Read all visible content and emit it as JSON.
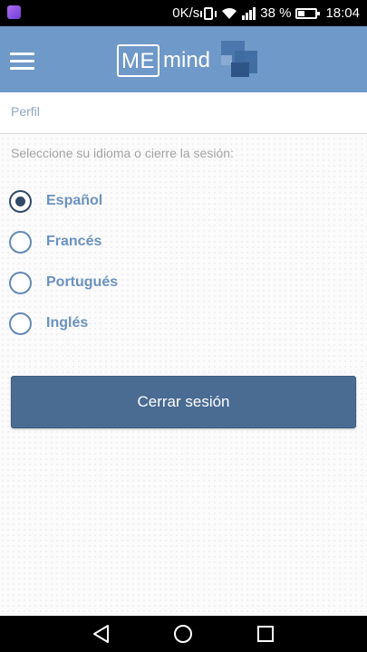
{
  "status_bar": {
    "network_speed": "0K/s",
    "battery_percent": "38 %",
    "battery_level": 0.38,
    "time": "18:04",
    "icons": [
      "app-notification-icon",
      "vibrate-icon",
      "wifi-icon",
      "signal-icon",
      "battery-icon"
    ]
  },
  "app_bar": {
    "menu_icon": "hamburger-menu-icon",
    "logo_me": "ME",
    "logo_mind": "mind",
    "logo_icon": "memind-logo-squares",
    "colors": {
      "background": "#6f99c8",
      "logo_dark": "#3d6a9f"
    }
  },
  "profile": {
    "title": "Perfil",
    "instruction": "Seleccione su idioma o cierre la sesión:",
    "selected_language": "Español",
    "languages": [
      {
        "label": "Español",
        "checked": true
      },
      {
        "label": "Francés",
        "checked": false
      },
      {
        "label": "Portugués",
        "checked": false
      },
      {
        "label": "Inglés",
        "checked": false
      }
    ],
    "logout_label": "Cerrar sesión",
    "colors": {
      "accent": "#6b92bf",
      "radio_selected": "#324a67",
      "button": "#4a6b92"
    }
  },
  "nav_bar": {
    "icons": [
      "back-triangle-icon",
      "home-circle-icon",
      "recents-square-icon"
    ]
  }
}
